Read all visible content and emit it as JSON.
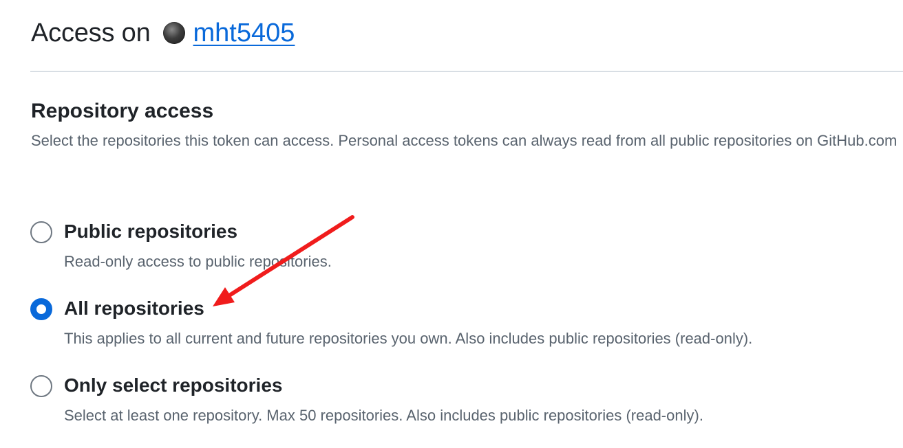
{
  "header": {
    "title_prefix": "Access on",
    "owner": "mht5405"
  },
  "repository_access": {
    "title": "Repository access",
    "description": "Select the repositories this token can access. Personal access tokens can always read from all public repositories on GitHub.com"
  },
  "options": [
    {
      "label": "Public repositories",
      "description": "Read-only access to public repositories.",
      "selected": false
    },
    {
      "label": "All repositories",
      "description": "This applies to all current and future repositories you own. Also includes public repositories (read-only).",
      "selected": true
    },
    {
      "label": "Only select repositories",
      "description": "Select at least one repository. Max 50 repositories. Also includes public repositories (read-only).",
      "selected": false
    }
  ],
  "colors": {
    "link": "#0969da",
    "radio_selected": "#0969da",
    "annotation_arrow": "#f01c1c"
  },
  "annotation": {
    "type": "arrow",
    "points_to": "All repositories"
  }
}
